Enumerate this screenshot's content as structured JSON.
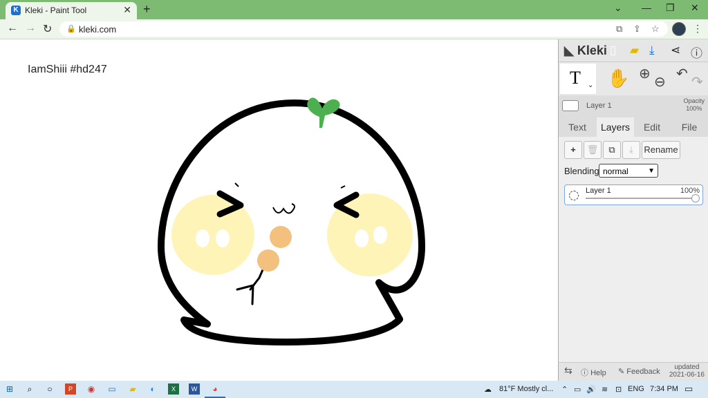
{
  "browser": {
    "tab_title": "Kleki - Paint Tool",
    "tab_favicon": "K",
    "url": "kleki.com"
  },
  "canvas": {
    "text": "IamShiii #hd247"
  },
  "panel": {
    "logo": "Kleki",
    "layer_name": "Layer 1",
    "opacity_label": "Opacity",
    "opacity_value": "100%",
    "tabs": [
      "Text",
      "Layers",
      "Edit",
      "File"
    ],
    "active_tab": "Layers",
    "rename_label": "Rename",
    "blending_label": "Blending",
    "blending_value": "normal",
    "layer_item": {
      "name": "Layer 1",
      "opacity": "100%"
    },
    "footer": {
      "help": "Help",
      "feedback": "Feedback",
      "updated_label": "updated",
      "updated_date": "2021-06-16"
    }
  },
  "taskbar": {
    "weather": "81°F  Mostly cl...",
    "lang": "ENG",
    "time": "7:34 PM"
  },
  "colors": {
    "chrome_frame": "#7dbb73",
    "sprout": "#4cb050",
    "blush": "#fff4b8",
    "dango": "#f4c07e"
  }
}
